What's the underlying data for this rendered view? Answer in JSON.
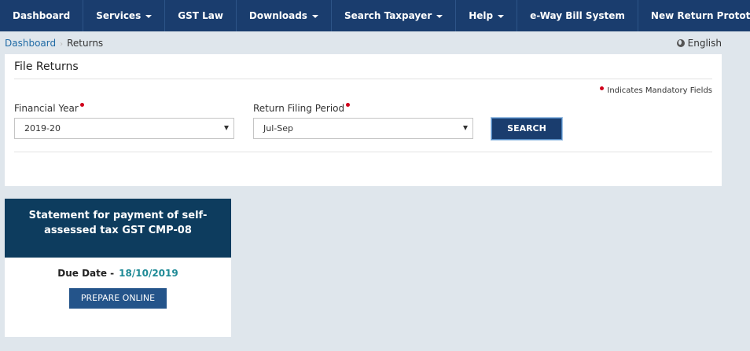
{
  "nav": {
    "items": [
      {
        "label": "Dashboard",
        "dropdown": false
      },
      {
        "label": "Services",
        "dropdown": true
      },
      {
        "label": "GST Law",
        "dropdown": false
      },
      {
        "label": "Downloads",
        "dropdown": true
      },
      {
        "label": "Search Taxpayer",
        "dropdown": true
      },
      {
        "label": "Help",
        "dropdown": true
      },
      {
        "label": "e-Way Bill System",
        "dropdown": false
      },
      {
        "label": "New Return Prototype",
        "dropdown": false
      }
    ]
  },
  "breadcrumb": {
    "home": "Dashboard",
    "current": "Returns"
  },
  "language": {
    "label": "English",
    "icon": "globe-icon"
  },
  "file_returns": {
    "title": "File Returns",
    "mandatory_note": "Indicates Mandatory Fields",
    "financial_year": {
      "label": "Financial Year",
      "value": "2019-20"
    },
    "return_period": {
      "label": "Return Filing Period",
      "value": "Jul-Sep"
    },
    "search_label": "SEARCH"
  },
  "card": {
    "title": "Statement for payment of self-assessed tax GST CMP-08",
    "due_label": "Due Date -",
    "due_date": "18/10/2019",
    "button_label": "PREPARE ONLINE"
  },
  "colors": {
    "navbar": "#1a3d6e",
    "card_header": "#0d3c5e",
    "due_date": "#1e8a96",
    "required": "#d0021b"
  }
}
